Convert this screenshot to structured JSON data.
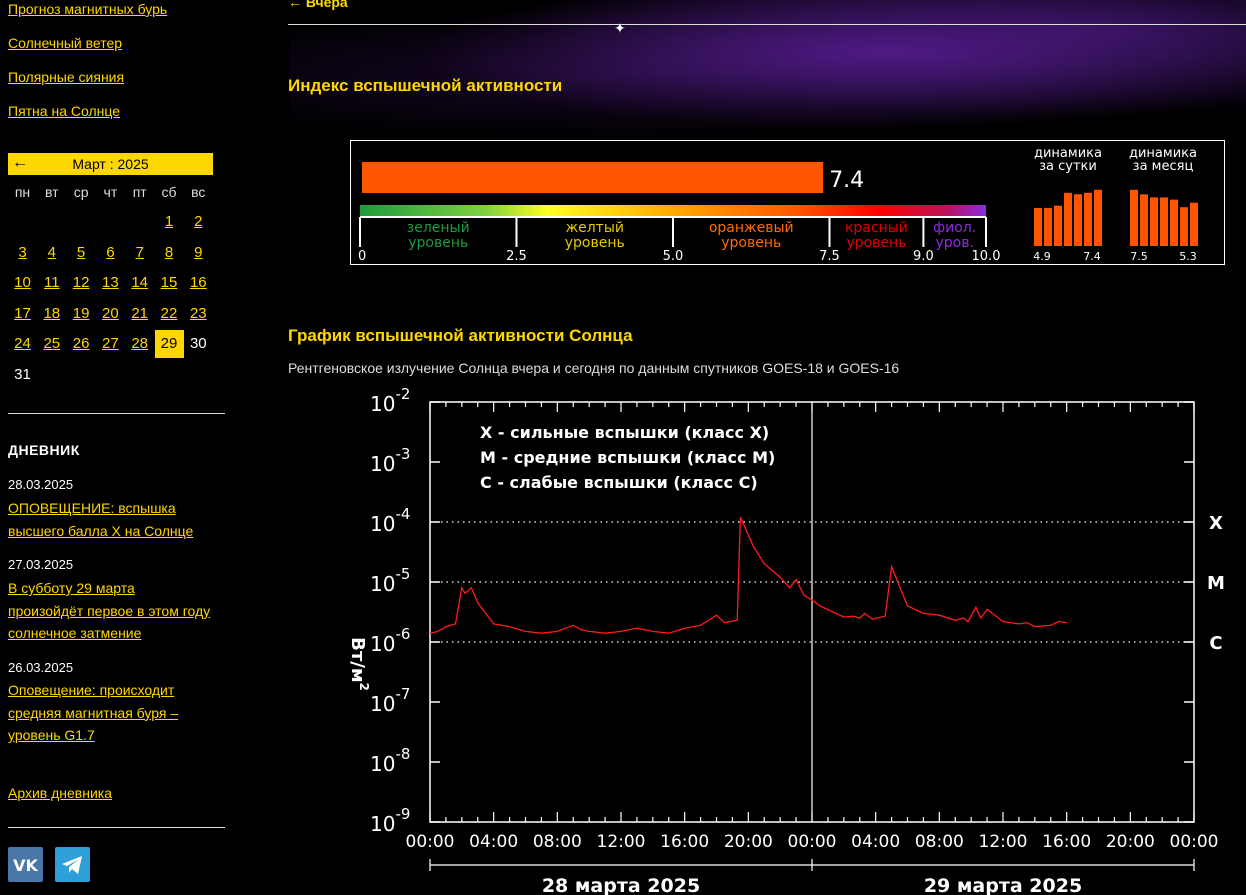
{
  "sidebar": {
    "nav": [
      "Прогноз магнитных бурь",
      "Солнечный ветер",
      "Полярные сияния",
      "Пятна на Солнце"
    ],
    "calendar": {
      "prev": "←",
      "title": "Март : 2025",
      "dow": [
        "пн",
        "вт",
        "ср",
        "чт",
        "пт",
        "сб",
        "вс"
      ],
      "weeks": [
        [
          "",
          "",
          "",
          "",
          "",
          "1",
          "2"
        ],
        [
          "3",
          "4",
          "5",
          "6",
          "7",
          "8",
          "9"
        ],
        [
          "10",
          "11",
          "12",
          "13",
          "14",
          "15",
          "16"
        ],
        [
          "17",
          "18",
          "19",
          "20",
          "21",
          "22",
          "23"
        ],
        [
          "24",
          "25",
          "26",
          "27",
          "28",
          "29",
          "30"
        ],
        [
          "31",
          "",
          "",
          "",
          "",
          "",
          ""
        ]
      ],
      "today": "29",
      "unlinked": [
        "30",
        "31"
      ]
    },
    "diary": {
      "title": "ДНЕВНИК",
      "entries": [
        {
          "date": "28.03.2025",
          "lines": [
            "ОПОВЕЩЕНИЕ: вспышка",
            "высшего балла X на Солнце"
          ]
        },
        {
          "date": "27.03.2025",
          "lines": [
            "В субботу 29 марта",
            "произойдёт первое в этом году",
            "солнечное затмение"
          ]
        },
        {
          "date": "26.03.2025",
          "lines": [
            "Оповещение: происходит",
            "средняя магнитная буря –",
            "уровень G1.7"
          ]
        }
      ],
      "archive": "Архив дневника"
    },
    "social": [
      {
        "name": "vk-icon",
        "label": "VK",
        "color": "#4a76a8"
      },
      {
        "name": "telegram-icon",
        "label": "",
        "color": "#2f9fd9"
      }
    ]
  },
  "main": {
    "back_link": "← Вчера",
    "flare_index": {
      "title": "Индекс вспышечной активности",
      "value": 7.4,
      "value_label": "7.4",
      "scale_ticks": [
        "0",
        "2.5",
        "5.0",
        "7.5",
        "9.0",
        "10.0"
      ],
      "levels": [
        {
          "line1": "зеленый",
          "line2": "уровень",
          "color": "#1e9b3c"
        },
        {
          "line1": "желтый",
          "line2": "уровень",
          "color": "#e6c800"
        },
        {
          "line1": "оранжевый",
          "line2": "уровень",
          "color": "#ff6a00"
        },
        {
          "line1": "красный",
          "line2": "уровень",
          "color": "#e00000"
        },
        {
          "line1": "фиол.",
          "line2": "уров.",
          "color": "#8a2be2"
        }
      ],
      "daily": {
        "title1": "динамика",
        "title2": "за сутки",
        "values": [
          5.0,
          5.0,
          5.3,
          7.0,
          6.8,
          7.0,
          7.4
        ],
        "from": "4.9",
        "to": "7.4"
      },
      "monthly": {
        "title1": "динамика",
        "title2": "за месяц",
        "values": [
          7.4,
          6.8,
          6.4,
          6.4,
          6.1,
          5.1,
          5.7
        ],
        "from": "7.5",
        "to": "5.3"
      },
      "bar_color": "#ff5500"
    },
    "graph": {
      "title": "График вспышечной активности Солнца",
      "subtitle": "Рентгеновское излучение Солнца вчера и сегодня по данным спутников GOES-18 и GOES-16"
    }
  },
  "chart_data": {
    "type": "line",
    "y_scale": "log",
    "ylim_exp": [
      -9,
      -2
    ],
    "y_tick_exponents": [
      -2,
      -3,
      -4,
      -5,
      -6,
      -7,
      -8,
      -9
    ],
    "ylabel_main": "Вт/м",
    "ylabel_sup": "2",
    "x_ticks": [
      "00:00",
      "04:00",
      "08:00",
      "12:00",
      "16:00",
      "20:00",
      "00:00",
      "04:00",
      "08:00",
      "12:00",
      "16:00",
      "20:00",
      "00:00"
    ],
    "x_range_hours": [
      0,
      48
    ],
    "days": [
      "28 марта 2025",
      "29 марта 2025"
    ],
    "legend": [
      "X - сильные вспышки (класс X)",
      "M - средние вспышки (класс M)",
      "C - слабые вспышки (класс C)"
    ],
    "class_lines": [
      {
        "label": "X",
        "exp": -4
      },
      {
        "label": "M",
        "exp": -5
      },
      {
        "label": "C",
        "exp": -6
      }
    ],
    "series": [
      {
        "color": "#ff1a1a",
        "x_hours": [
          0,
          0.5,
          1,
          1.6,
          2.0,
          2.2,
          2.6,
          3.0,
          3.5,
          4,
          5,
          6,
          7,
          8,
          9,
          9.5,
          10,
          11,
          12,
          13,
          14,
          15,
          16,
          17,
          18,
          18.5,
          19.3,
          19.5,
          19.8,
          20.3,
          21,
          22,
          22.6,
          23,
          23.5,
          24,
          24.5,
          26,
          26.6,
          27,
          27.3,
          27.8,
          28.6,
          29,
          30,
          31,
          32,
          33,
          33.5,
          33.8,
          34.3,
          34.6,
          35,
          36,
          37,
          37.5,
          38,
          39,
          39.5,
          40
        ],
        "values": [
          1.4e-06,
          1.5e-06,
          1.8e-06,
          2e-06,
          8e-06,
          6.5e-06,
          8e-06,
          4.5e-06,
          3e-06,
          2e-06,
          1.8e-06,
          1.5e-06,
          1.4e-06,
          1.5e-06,
          1.9e-06,
          1.6e-06,
          1.5e-06,
          1.4e-06,
          1.5e-06,
          1.7e-06,
          1.5e-06,
          1.4e-06,
          1.7e-06,
          1.9e-06,
          2.8e-06,
          2.1e-06,
          2.3e-06,
          0.00012,
          8e-05,
          4e-05,
          2e-05,
          1.2e-05,
          8e-06,
          1.1e-05,
          6e-06,
          5e-06,
          4e-06,
          2.6e-06,
          2.7e-06,
          2.5e-06,
          3e-06,
          2.4e-06,
          2.7e-06,
          1.8e-05,
          4e-06,
          3e-06,
          2.8e-06,
          2.3e-06,
          2.5e-06,
          2.2e-06,
          3.8e-06,
          2.5e-06,
          3.5e-06,
          2.2e-06,
          2e-06,
          2.1e-06,
          1.8e-06,
          1.9e-06,
          2.2e-06,
          2.1e-06
        ]
      }
    ]
  }
}
